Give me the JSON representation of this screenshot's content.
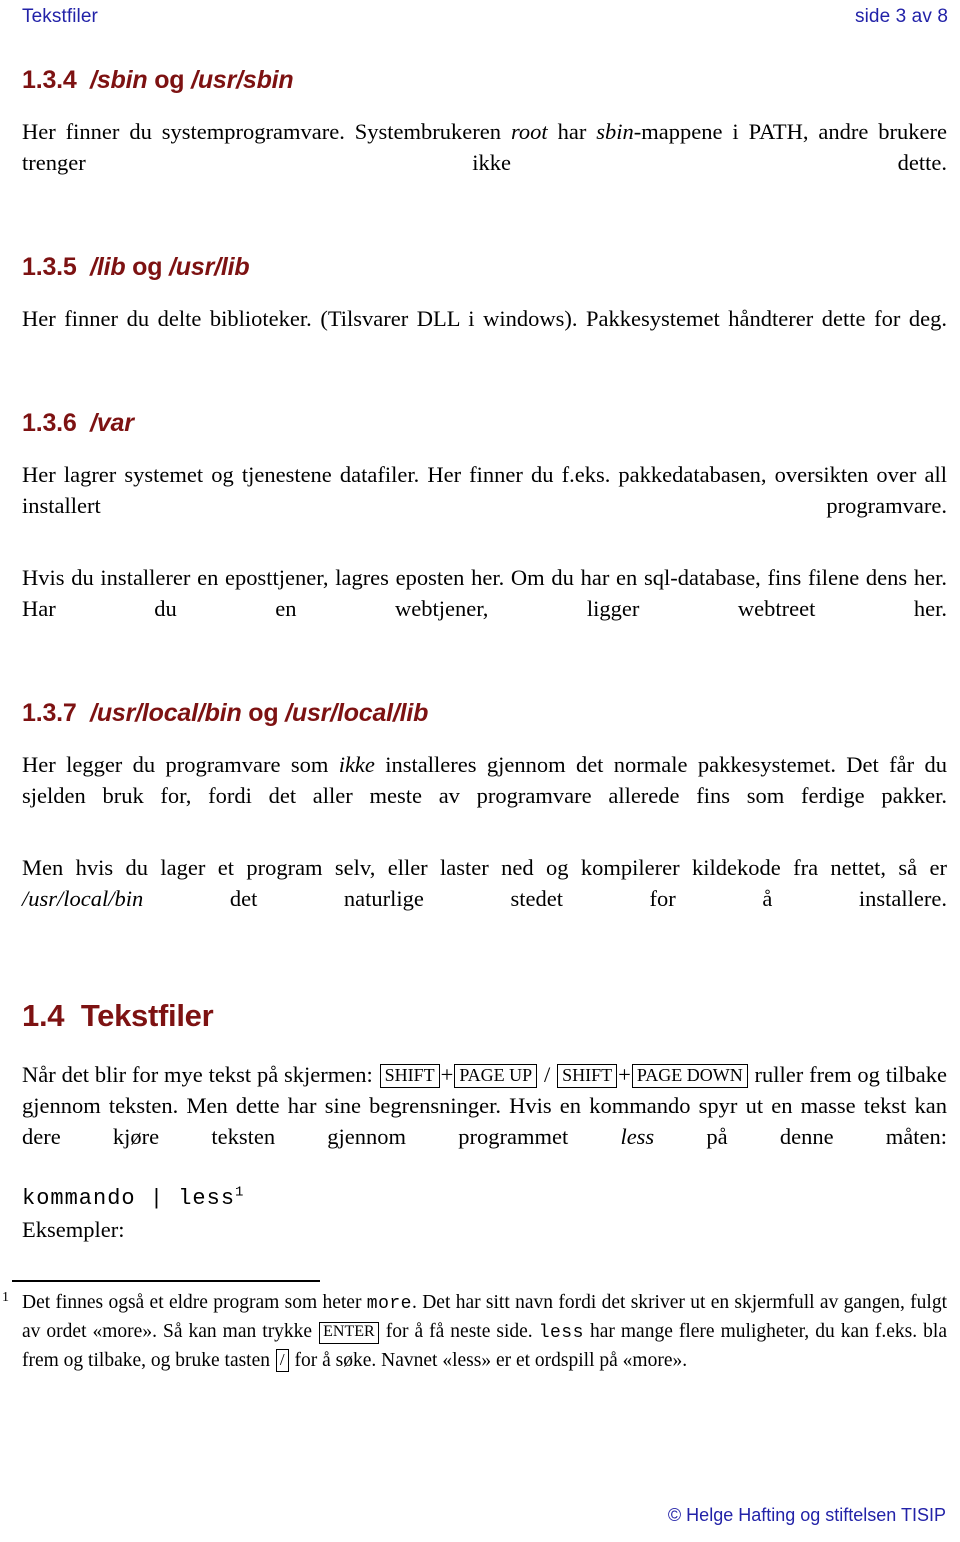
{
  "header": {
    "left_title": "Tekstfiler",
    "right_pagination": "side 3 av 8",
    "color": "#2222a8"
  },
  "theme": {
    "heading_color": "#7d1212",
    "header_color": "#2222a8",
    "body_color": "#000000",
    "page_background": "#ffffff"
  },
  "sections": [
    {
      "id": "sbin",
      "number": "1.3.4",
      "title_path_1": "/sbin",
      "title_conj": " og ",
      "title_path_2": "/usr/sbin",
      "paragraphs": [
        {
          "parts": [
            {
              "text": "Her finner du systemprogramvare. Systembrukeren ",
              "style": "normal"
            },
            {
              "text": "root",
              "style": "italic"
            },
            {
              "text": " har ",
              "style": "normal"
            },
            {
              "text": "sbin",
              "style": "italic"
            },
            {
              "text": "-mappene i PATH, andre brukere trenger ikke dette.",
              "style": "normal"
            }
          ]
        }
      ]
    },
    {
      "id": "lib",
      "number": "1.3.5",
      "title_path_1": "/lib",
      "title_conj": " og ",
      "title_path_2": "/usr/lib",
      "paragraphs": [
        {
          "parts": [
            {
              "text": "Her finner du delte biblioteker. (Tilsvarer DLL i windows). Pakkesystemet håndterer dette for deg.",
              "style": "normal"
            }
          ]
        }
      ]
    },
    {
      "id": "var",
      "number": "1.3.6",
      "title_path_1": "/var",
      "title_conj": "",
      "title_path_2": "",
      "paragraphs": [
        {
          "parts": [
            {
              "text": "Her lagrer systemet og tjenestene datafiler. Her finner du f.eks. pakkedatabasen, oversikten over all installert programvare.",
              "style": "normal"
            }
          ]
        },
        {
          "parts": [
            {
              "text": "Hvis du installerer en eposttjener, lagres eposten her. Om du har en sql-database, fins filene dens her. Har du en webtjener, ligger webtreet her.",
              "style": "normal"
            }
          ]
        }
      ]
    },
    {
      "id": "usrlocal",
      "number": "1.3.7",
      "title_path_1": "/usr/local/bin",
      "title_conj": " og ",
      "title_path_2": "/usr/local/lib",
      "paragraphs": [
        {
          "parts": [
            {
              "text": "Her legger du programvare som ",
              "style": "normal"
            },
            {
              "text": "ikke",
              "style": "italic"
            },
            {
              "text": " installeres gjennom det normale pakkesystemet. Det får du sjelden bruk for, fordi det aller meste av programvare allerede fins som ferdige pakker.",
              "style": "normal"
            }
          ]
        },
        {
          "parts": [
            {
              "text": "Men hvis du lager et program selv, eller laster ned og kompilerer kildekode fra nettet, så er ",
              "style": "normal"
            },
            {
              "text": "/usr/local/bin",
              "style": "italic"
            },
            {
              "text": " det naturlige stedet for å installere.",
              "style": "normal"
            }
          ]
        }
      ]
    }
  ],
  "main_section": {
    "number": "1.4",
    "title": "Tekstfiler",
    "intro": {
      "lead": "Når det blir for mye tekst på skjermen: ",
      "keys": [
        {
          "label": "SHIFT"
        },
        {
          "label": "PAGE UP"
        },
        {
          "label": "SHIFT"
        },
        {
          "label": "PAGE DOWN"
        }
      ],
      "plus": "+",
      "separator": "/",
      "after_keys": " ruller frem og tilbake gjennom teksten. Men dette har sine begrensninger. Hvis en kommando spyr ut en masse tekst kan dere kjøre teksten gjennom programmet ",
      "program_name": "less",
      "tail": " på denne måten:"
    },
    "command_line": "kommando | less",
    "command_footnote_mark": "1",
    "examples_label": "Eksempler:"
  },
  "footnote": {
    "marker": "1",
    "part_1": "Det finnes også et eldre program som heter ",
    "mono_1": "more",
    "part_2": ". Det har sitt navn fordi det skriver ut en skjermfull av gangen, fulgt av ordet «more». Så kan man trykke ",
    "key_enter": "ENTER",
    "part_3": " for å få neste side. ",
    "mono_2": "less",
    "part_4": " har mange flere muligheter, du kan f.eks. bla frem og tilbake, og bruke tasten ",
    "key_slash": "/",
    "part_5": " for å søke. Navnet «less» er et ordspill på «more»."
  },
  "footer": {
    "copyright": "© Helge Hafting og stiftelsen TISIP"
  }
}
